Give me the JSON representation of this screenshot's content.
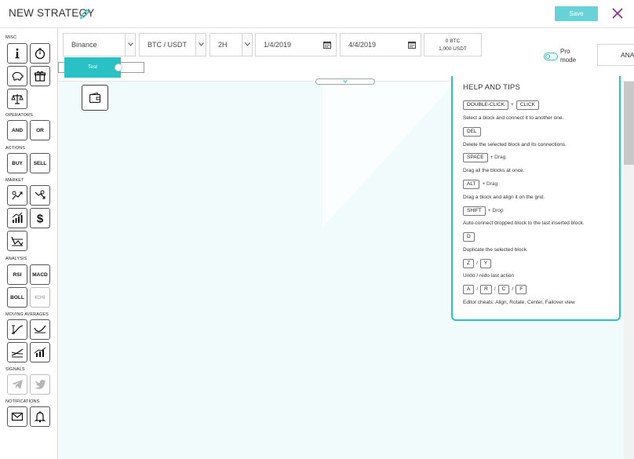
{
  "header": {
    "title": "NEW STRATEGY",
    "save_label": "Save"
  },
  "sidebar": {
    "sections": {
      "misc": "MISC",
      "operators": "OPERATORS",
      "actions": "ACTIONS",
      "market": "MARKET",
      "analysis": "ANALYSIS",
      "moving_averages": "MOVING AVERAGES",
      "signals": "SIGNALS",
      "notifications": "NOTIFICATIONS"
    },
    "labels": {
      "and": "AND",
      "or": "OR",
      "buy": "BUY",
      "sell": "SELL",
      "rsi": "RSI",
      "macd": "MACD",
      "boll": "BOLL",
      "ichi": "ICHI"
    }
  },
  "toolbar": {
    "exchange": "Binance",
    "pair": "BTC / USDT",
    "timeframe": "2H",
    "start_date": "1/4/2019",
    "end_date": "4/4/2019",
    "balance_btc": "0 BTC",
    "balance_usdt": "1,000 USDT",
    "test_label": "Test",
    "pro_mode_label": "Pro mode",
    "analyze_label": "ANALYZE"
  },
  "help": {
    "title": "HELP AND TIPS",
    "tips": [
      {
        "keys": [
          "DOUBLE-CLICK",
          "CLICK"
        ],
        "joiner": "+",
        "text": "Select a block and connect it to another one."
      },
      {
        "keys": [
          "DEL"
        ],
        "text": "Delete the selected block and its connections."
      },
      {
        "keys": [
          "SPACE"
        ],
        "suffix": "+ Drag",
        "text": "Drag all the blocks at once."
      },
      {
        "keys": [
          "ALT"
        ],
        "suffix": "+ Drag",
        "text": "Drag a block and align it on the grid."
      },
      {
        "keys": [
          "SHIFT"
        ],
        "suffix": "+ Drop",
        "text": "Auto-connect dropped block to the last inserted block."
      },
      {
        "keys": [
          "D"
        ],
        "text": "Duplicate the selected block."
      },
      {
        "keys": [
          "Z",
          "Y"
        ],
        "joiner": "/",
        "text": "Undo / redo last action"
      },
      {
        "keys": [
          "A",
          "R",
          "C",
          "F"
        ],
        "joiner": "/",
        "text": "Editor cheats: Align, Rotate, Center, Failover view"
      }
    ]
  },
  "colors": {
    "accent": "#29c1c3",
    "save_button": "#67d3d8",
    "close_icon": "#8b2a8f",
    "canvas_bg": "#f1fbfb"
  }
}
